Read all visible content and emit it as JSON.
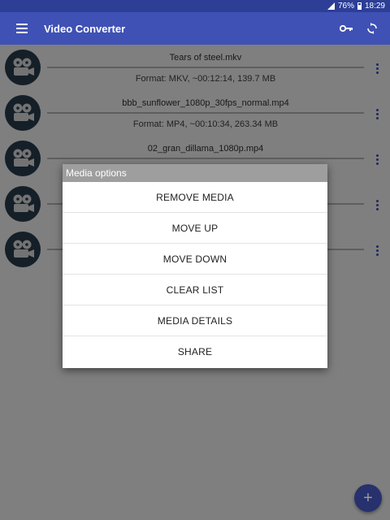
{
  "status_bar": {
    "battery": "76%",
    "time": "18:29"
  },
  "app_bar": {
    "title": "Video Converter"
  },
  "media_items": [
    {
      "name": "Tears of steel.mkv",
      "meta": "Format: MKV, ~00:12:14, 139.7 MB"
    },
    {
      "name": "bbb_sunflower_1080p_30fps_normal.mp4",
      "meta": "Format: MP4, ~00:10:34, 263.34 MB"
    },
    {
      "name": "02_gran_dillama_1080p.mp4",
      "meta": ""
    },
    {
      "name": "",
      "meta": ""
    },
    {
      "name": "",
      "meta": ""
    }
  ],
  "dialog": {
    "title": "Media options",
    "options": [
      "REMOVE MEDIA",
      "MOVE UP",
      "MOVE DOWN",
      "CLEAR LIST",
      "MEDIA DETAILS",
      "SHARE"
    ]
  },
  "fab": {
    "label": "+"
  },
  "colors": {
    "primary": "#3f51b5",
    "status_bar": "#2c3e96",
    "dialog_title_bg": "#9e9e9e"
  }
}
